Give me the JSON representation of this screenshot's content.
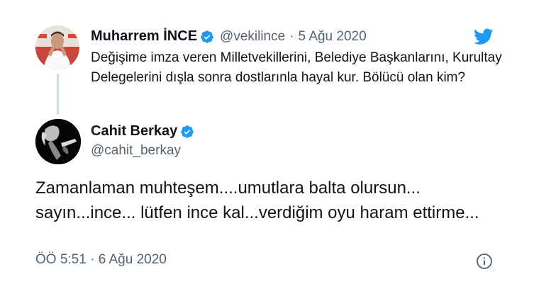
{
  "quoted_tweet": {
    "name": "Muharrem İNCE",
    "handle": "@vekilince",
    "separator": "·",
    "date": "5 Ağu 2020",
    "text": "Değişime imza veren Milletvekillerini, Belediye Başkanlarını, Kurultay Delegelerini dışla sonra dostlarınla hayal kur. Bölücü olan kim?",
    "verified": true
  },
  "reply_tweet": {
    "name": "Cahit Berkay",
    "handle": "@cahit_berkay",
    "verified": true,
    "text": "Zamanlaman muhteşem....umutlara balta olursun... sayın...ince... lütfen ince kal...verdiğim oyu haram ettirme...",
    "timestamp": "ÖÖ 5:51 · 6 Ağu 2020"
  },
  "icons": {
    "brand": "twitter-bird-icon",
    "verified": "verified-badge-icon",
    "info": "info-icon"
  },
  "colors": {
    "brand": "#1d9bf0",
    "text": "#0f1419",
    "secondary": "#536471",
    "thread_line": "#cfd9de"
  }
}
